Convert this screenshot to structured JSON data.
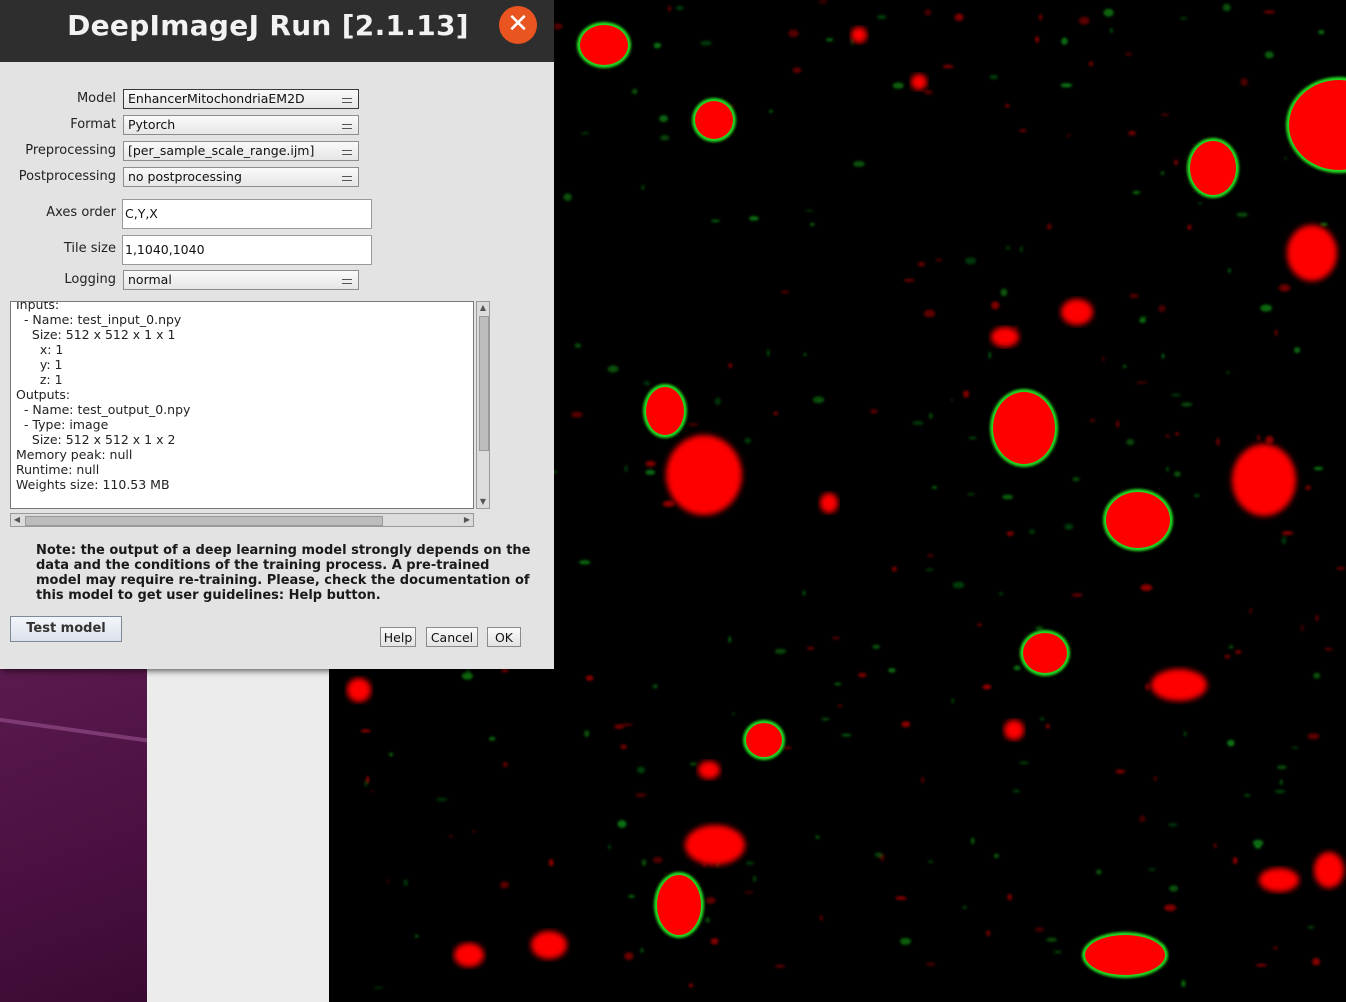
{
  "dialog": {
    "title": "DeepImageJ Run [2.1.13]",
    "close_symbol": "✕",
    "fields": {
      "model_label": "Model",
      "model_value": "EnhancerMitochondriaEM2D",
      "format_label": "Format",
      "format_value": "Pytorch",
      "preprocessing_label": "Preprocessing",
      "preprocessing_value": "[per_sample_scale_range.ijm]",
      "postprocessing_label": "Postprocessing",
      "postprocessing_value": "no postprocessing",
      "axes_order_label": "Axes order",
      "axes_order_value": "C,Y,X",
      "tile_size_label": "Tile size",
      "tile_size_value": "1,1040,1040",
      "logging_label": "Logging",
      "logging_value": "normal"
    },
    "info_text": "Inputs:\n  - Name: test_input_0.npy\n    Size: 512 x 512 x 1 x 1\n      x: 1\n      y: 1\n      z: 1\nOutputs:\n  - Name: test_output_0.npy\n  - Type: image\n    Size: 512 x 512 x 1 x 2\nMemory peak: null\nRuntime: null\nWeights size: 110.53 MB",
    "note": "Note: the output of a deep learning model strongly depends on the data and the conditions of the training process. A pre-trained model may require re-training. Please, check the documentation of this model to get user guidelines: Help button.",
    "buttons": {
      "test_model": "Test model",
      "help": "Help",
      "cancel": "Cancel",
      "ok": "OK"
    },
    "colors": {
      "titlebar": "#2f2e2e",
      "close_button": "#e95420",
      "dialog_bg": "#e3e3e3"
    }
  },
  "image_viewer": {
    "colors": {
      "cell_fill": "#ff0000",
      "cell_edge": "#22dd22",
      "background": "#000000"
    }
  },
  "desktop": {
    "colors": {
      "wallpaper": "#4a0f40",
      "side_panel": "#ececec"
    }
  }
}
